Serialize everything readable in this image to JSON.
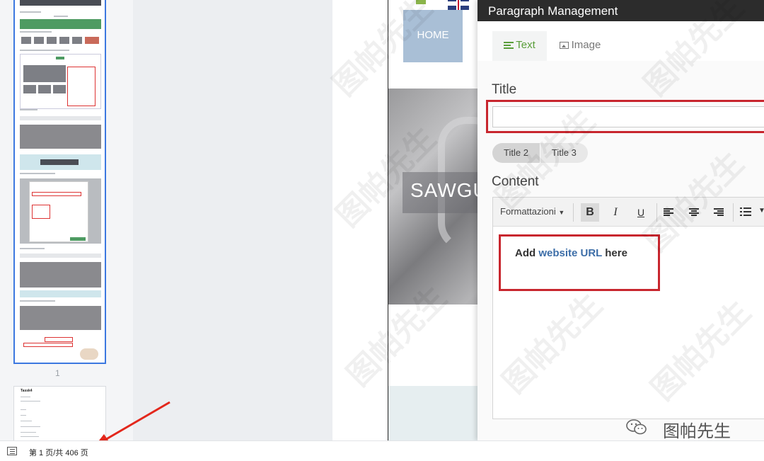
{
  "viewer": {
    "thumbnail_page_number": "1",
    "status_text": "第 1 页/共 406 页"
  },
  "thumbnails": {
    "page2_title": "Tassk4"
  },
  "website": {
    "nav_home": "HOME",
    "hero_title": "SAWGU"
  },
  "modal": {
    "title": "Paragraph Management",
    "tabs": [
      {
        "label": "Text",
        "icon": "paragraph-lines-icon",
        "active": true
      },
      {
        "label": "Image",
        "icon": "picture-icon",
        "active": false
      }
    ],
    "title_label": "Title",
    "title_value": "",
    "heading_buttons": [
      "Title 2",
      "Title 3"
    ],
    "content_label": "Content",
    "toolbar": {
      "format_select": "Formattazioni",
      "bold": "B",
      "italic": "I",
      "underline": "U"
    },
    "content": {
      "prefix": "Add ",
      "link": "website URL",
      "suffix": " here"
    }
  },
  "watermark": {
    "text": "图帕先生",
    "brand_label": "图帕先生"
  },
  "colors": {
    "accent_green": "#5a9e3a",
    "highlight_red": "#c8262e",
    "thumbnail_selected": "#3c78e0",
    "header_dark": "#2c2c2c"
  }
}
